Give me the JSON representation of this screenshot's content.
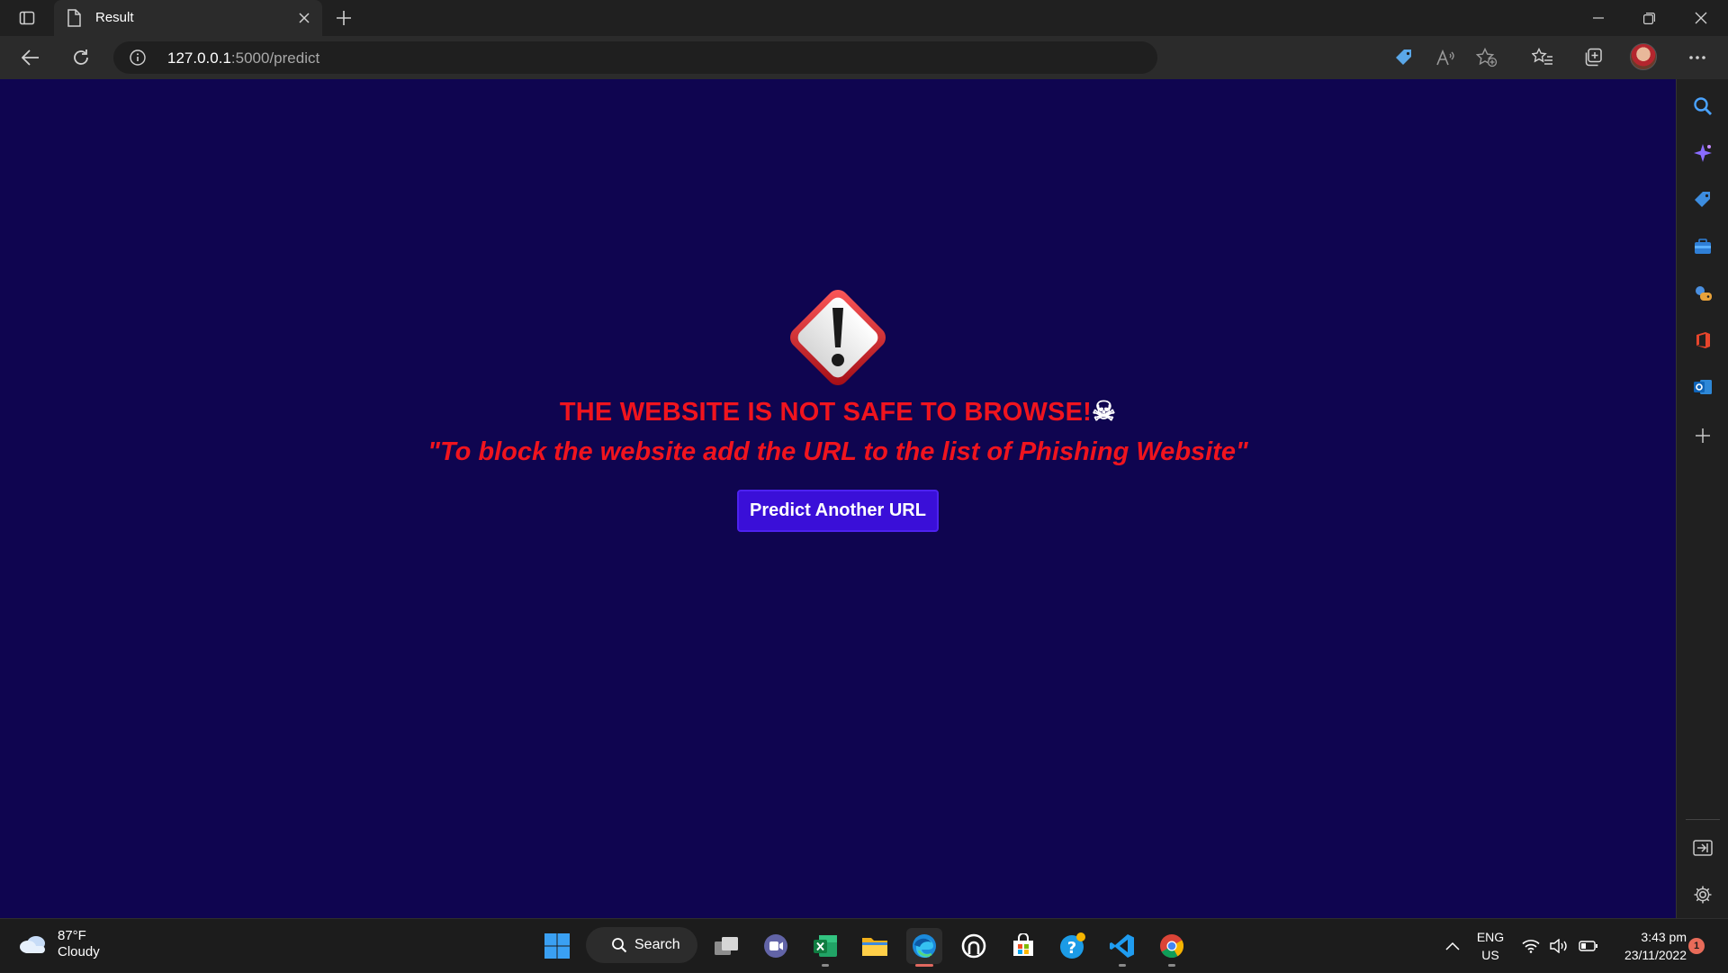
{
  "browser": {
    "tab_title": "Result",
    "url_host": "127.0.0.1",
    "url_rest": ":5000/predict"
  },
  "page": {
    "headline": "THE WEBSITE IS NOT SAFE TO BROWSE!",
    "headline_emoji": "☠",
    "subline": "\"To block the website add the URL to the list of Phishing Website\"",
    "button_label": "Predict Another URL",
    "background_color": "#0f0550",
    "text_color": "#f0141e",
    "button_color": "#3a0fd8"
  },
  "sidebar": {
    "icons": [
      "search-icon",
      "copilot-icon",
      "shopping-tag-icon",
      "tools-briefcase-icon",
      "games-icon",
      "office-icon",
      "outlook-icon",
      "add-icon",
      "split-screen-icon",
      "settings-icon"
    ]
  },
  "taskbar": {
    "weather_temp": "87°F",
    "weather_condition": "Cloudy",
    "search_label": "Search",
    "lang_line1": "ENG",
    "lang_line2": "US",
    "time": "3:43 pm",
    "date": "23/11/2022",
    "notification_count": "1",
    "pinned_apps": [
      "start-button",
      "task-view",
      "teams-chat",
      "excel",
      "file-explorer",
      "edge",
      "github-copilot-app",
      "microsoft-store",
      "help-app",
      "vscode",
      "chrome"
    ]
  }
}
